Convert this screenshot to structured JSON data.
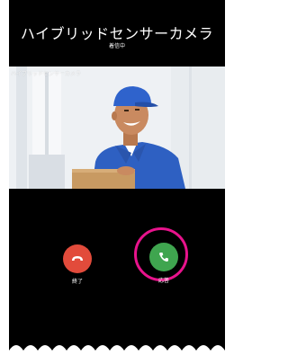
{
  "header": {
    "title": "ハイブリッドセンサーカメラ",
    "status": "着信中"
  },
  "video": {
    "caption": "ハイブリッドセンサーカメラ"
  },
  "controls": {
    "end_label": "終了",
    "answer_label": "応答"
  },
  "icons": {
    "end": "phone-hangup-icon",
    "answer": "phone-answer-icon"
  },
  "colors": {
    "end_button": "#e24b3b",
    "answer_button": "#3fa54f",
    "highlight_ring": "#e8138c",
    "background": "#000000"
  }
}
